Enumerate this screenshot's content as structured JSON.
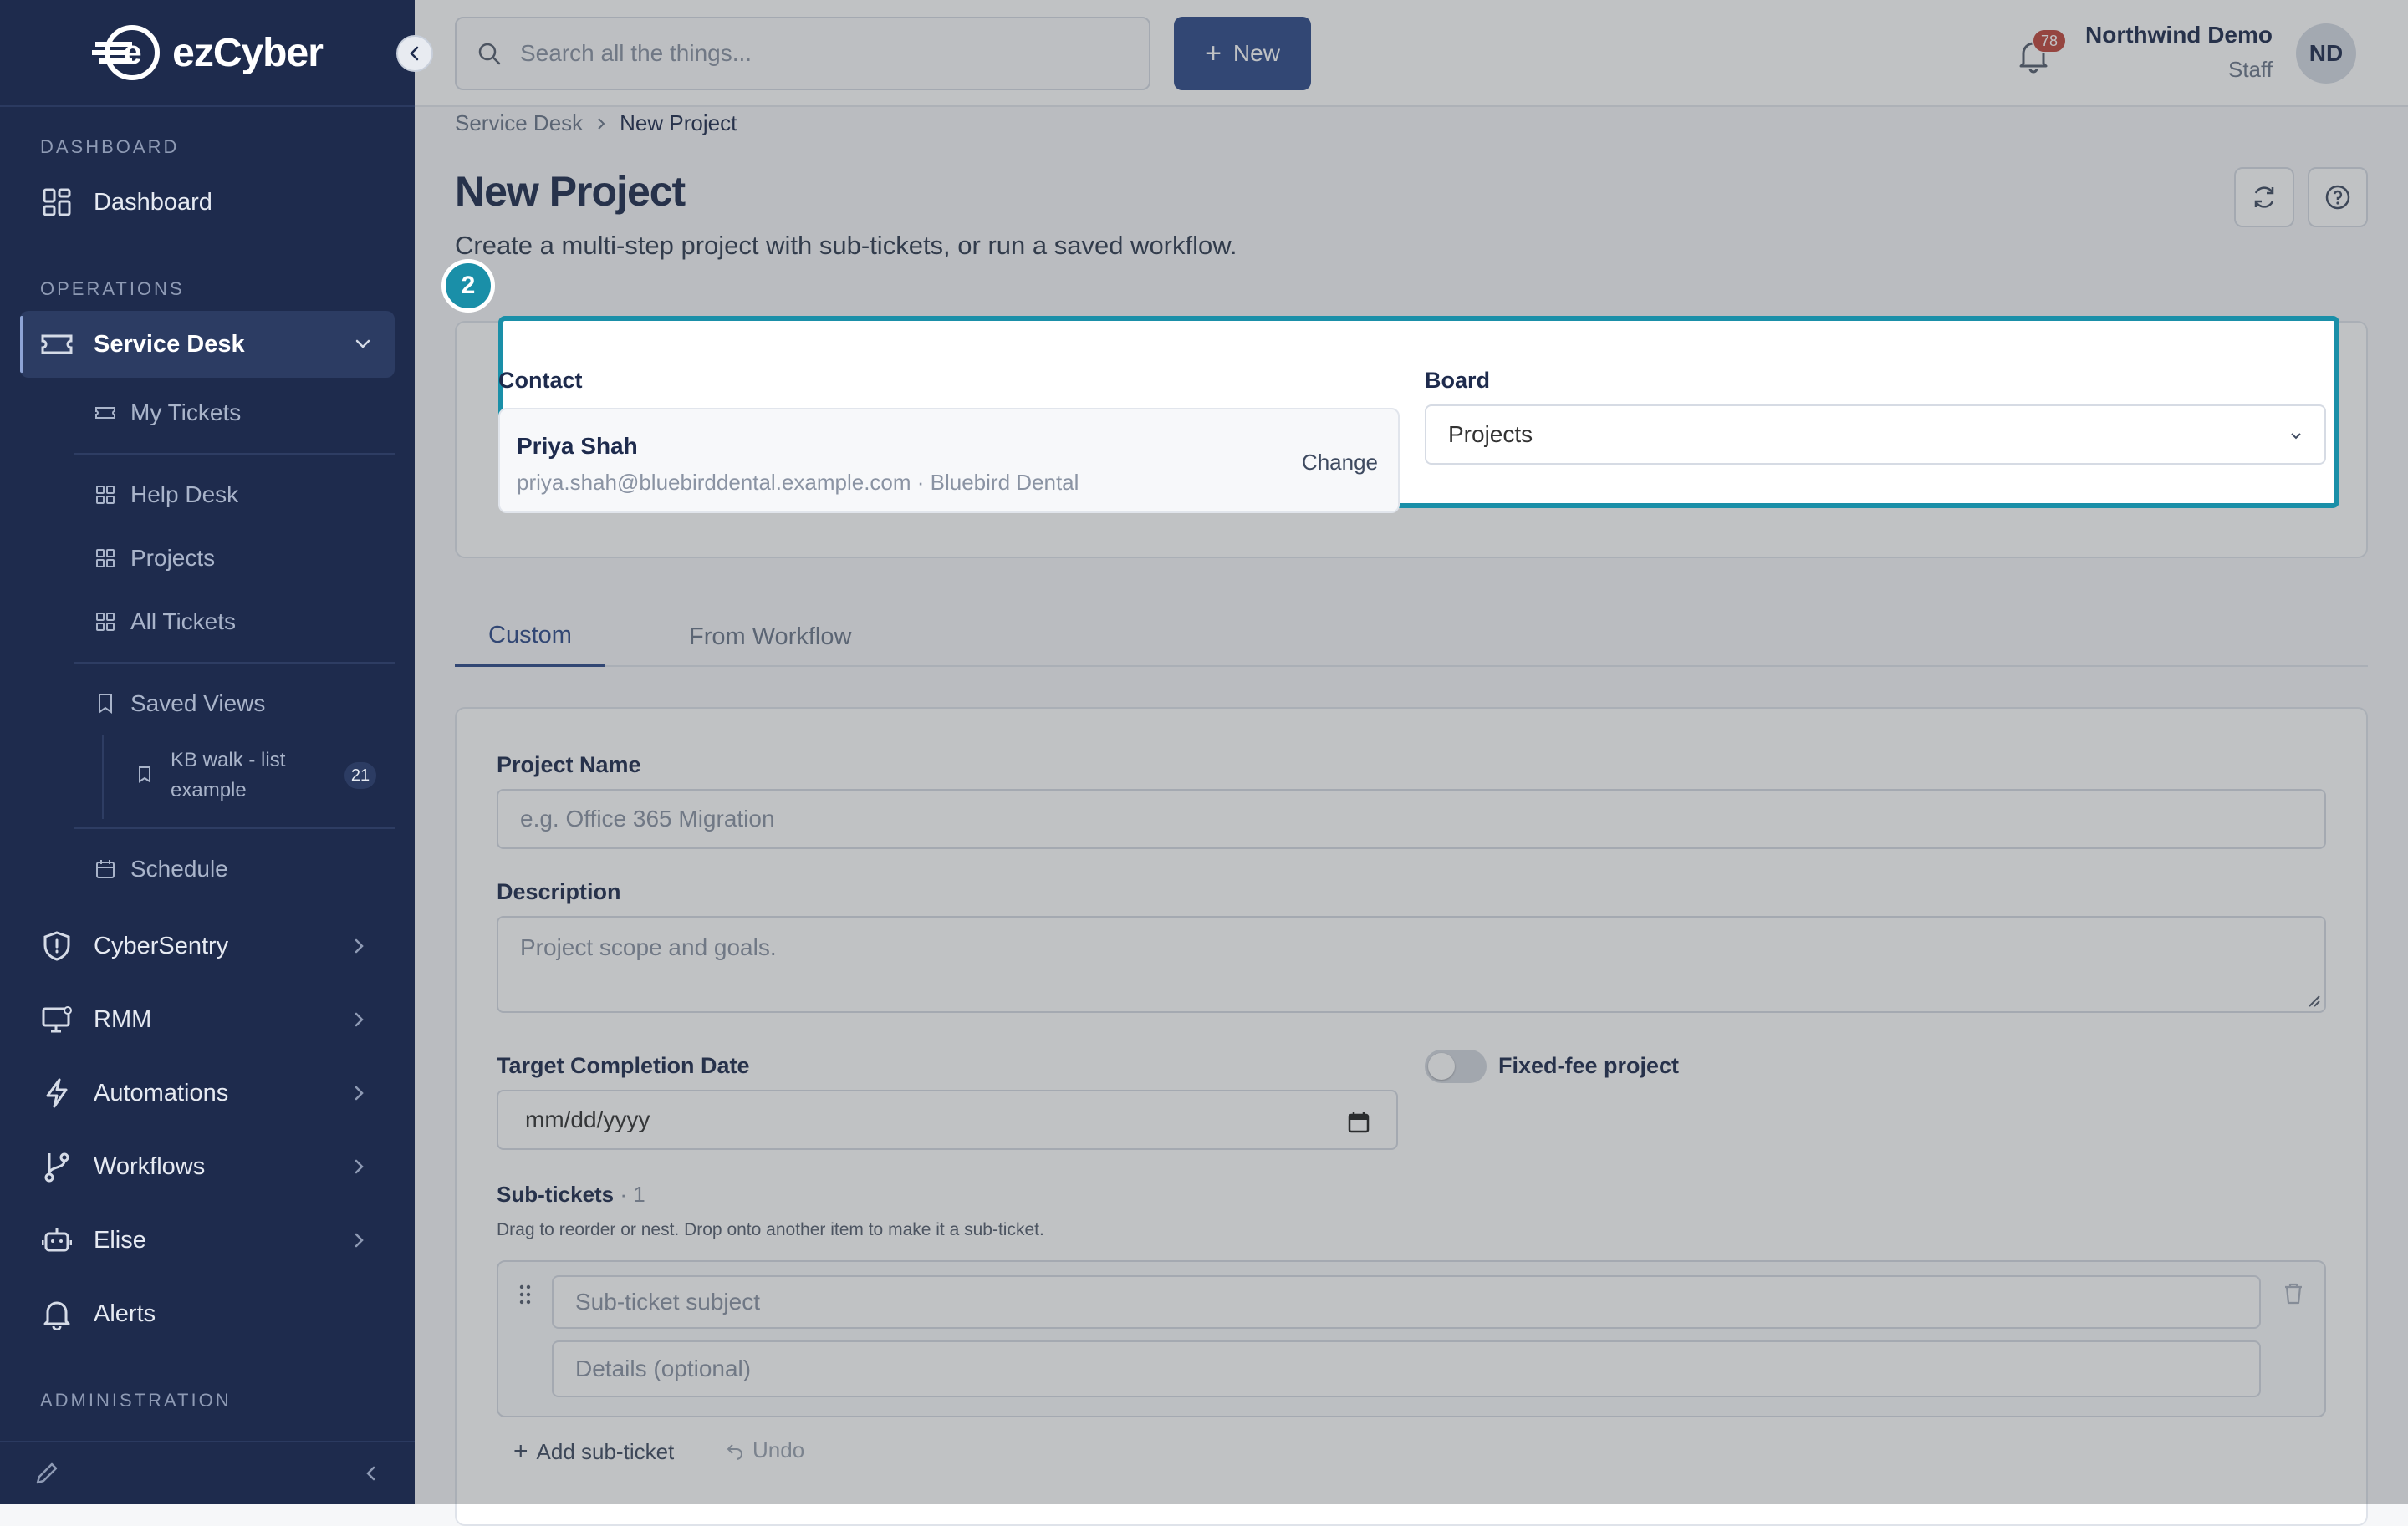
{
  "sidebar": {
    "brand": "ezCyber",
    "sections": {
      "dashboard": "DASHBOARD",
      "operations": "OPERATIONS",
      "administration": "ADMINISTRATION"
    },
    "dashboard_label": "Dashboard",
    "service_desk_label": "Service Desk",
    "sub_items": {
      "my_tickets": "My Tickets",
      "help_desk": "Help Desk",
      "projects": "Projects",
      "all_tickets": "All Tickets",
      "saved_views": "Saved Views",
      "kb_walk_line1": "KB walk - list",
      "kb_walk_line2": "example",
      "kb_walk_count": "21",
      "schedule": "Schedule"
    },
    "cybersentry": "CyberSentry",
    "rmm": "RMM",
    "automations": "Automations",
    "workflows": "Workflows",
    "elise": "Elise",
    "alerts": "Alerts"
  },
  "topbar": {
    "search_placeholder": "Search all the things...",
    "new_label": "New",
    "notifications_count": "78",
    "user_name": "Northwind Demo",
    "user_role": "Staff",
    "avatar_initials": "ND"
  },
  "breadcrumb": {
    "parent": "Service Desk",
    "current": "New Project"
  },
  "page": {
    "title": "New Project",
    "subtitle": "Create a multi-step project with sub-tickets, or run a saved workflow."
  },
  "tour": {
    "step": "2"
  },
  "contact": {
    "label": "Contact",
    "name": "Priya Shah",
    "details": "priya.shah@bluebirddental.example.com · Bluebird Dental",
    "change_label": "Change"
  },
  "board": {
    "label": "Board",
    "value": "Projects"
  },
  "tabs": {
    "custom": "Custom",
    "from_workflow": "From Workflow"
  },
  "form": {
    "project_name_label": "Project Name",
    "project_name_placeholder": "e.g. Office 365 Migration",
    "description_label": "Description",
    "description_placeholder": "Project scope and goals.",
    "target_date_label": "Target Completion Date",
    "target_date_placeholder": "mm/dd/yyyy",
    "fixed_fee_label": "Fixed-fee project",
    "subtickets_label": "Sub-tickets",
    "subtickets_count": "· 1",
    "subtickets_hint": "Drag to reorder or nest. Drop onto another item to make it a sub-ticket.",
    "subticket_subject_placeholder": "Sub-ticket subject",
    "subticket_details_placeholder": "Details (optional)",
    "add_subticket_label": "Add sub-ticket",
    "undo_label": "Undo"
  }
}
